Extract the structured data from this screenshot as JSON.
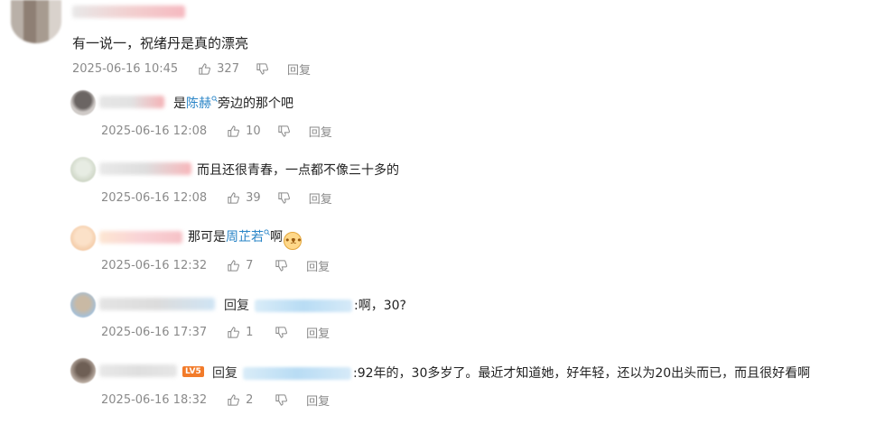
{
  "comments": [
    {
      "text": "有一说一，祝绪丹是真的漂亮",
      "timestamp": "2025-06-16 10:45",
      "likes": "327",
      "reply_label": "回复"
    }
  ],
  "replies": [
    {
      "prefix": "是",
      "mention": "陈赫",
      "suffix": "旁边的那个吧",
      "timestamp": "2025-06-16 12:08",
      "likes": "10",
      "reply_label": "回复"
    },
    {
      "text": "而且还很青春，一点都不像三十多的",
      "timestamp": "2025-06-16 12:08",
      "likes": "39",
      "reply_label": "回复"
    },
    {
      "prefix": "那可是",
      "mention": "周芷若",
      "suffix": "啊",
      "emoji": "cat-face-emoji",
      "timestamp": "2025-06-16 12:32",
      "likes": "7",
      "reply_label": "回复"
    },
    {
      "reply_word": "回复",
      "text": ":啊，30?",
      "timestamp": "2025-06-16 17:37",
      "likes": "1",
      "reply_label": "回复"
    },
    {
      "reply_word": "回复",
      "text": ":92年的，30多岁了。最近才知道她，好年轻，还以为20出头而已，而且很好看啊",
      "badge": "LV5",
      "timestamp": "2025-06-16 18:32",
      "likes": "2",
      "reply_label": "回复"
    }
  ],
  "icons": {
    "like": "thumbs-up-icon",
    "dislike": "thumbs-down-icon",
    "mention_search": "search-mini-icon"
  },
  "colors": {
    "text": "#222222",
    "meta": "#8a8a8a",
    "mention": "#2a85c7",
    "badge": "#f27b2a"
  }
}
